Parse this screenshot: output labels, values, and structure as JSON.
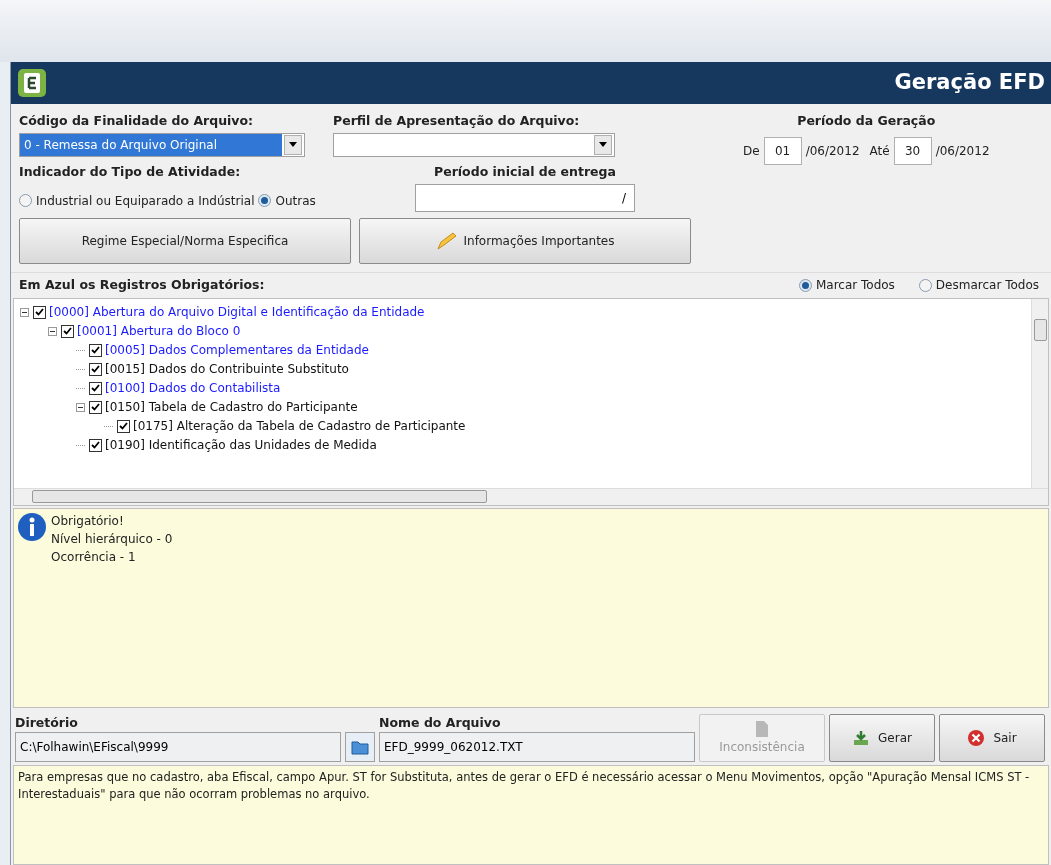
{
  "window": {
    "title": "Geração EFD"
  },
  "finalidade": {
    "label": "Código da Finalidade do Arquivo:",
    "value": "0 - Remessa do Arquivo Original"
  },
  "perfil": {
    "label": "Perfil de Apresentação do Arquivo:"
  },
  "periodo_geracao": {
    "label": "Período da Geração",
    "from_label": "De",
    "from_day": "01",
    "from_rest": "/06/2012",
    "to_label": "Até",
    "to_day": "30",
    "to_rest": "/06/2012"
  },
  "tipo_atividade": {
    "label": "Indicador do Tipo de Atividade:",
    "options": [
      {
        "label": "Industrial ou Equiparado a Indústrial",
        "selected": false
      },
      {
        "label": "Outras",
        "selected": true
      }
    ]
  },
  "periodo_inicial": {
    "label": "Período inicial de entrega",
    "value": "/"
  },
  "buttons": [
    {
      "label": "Regime Especial/Norma Especifica",
      "kind": "plain"
    },
    {
      "label": "Informações Importantes",
      "kind": "pencil"
    }
  ],
  "tree_section": {
    "label": "Em Azul os Registros Obrigatórios:",
    "options": [
      {
        "label": "Marcar Todos",
        "selected": true
      },
      {
        "label": "Desmarcar Todos",
        "selected": false
      }
    ]
  },
  "tree": [
    {
      "label": "[0000] Abertura do Arquivo Digital e Identificação da Entidade",
      "mandatory": true,
      "checked": true,
      "expanded": true,
      "children": [
        {
          "label": "[0001] Abertura do Bloco 0",
          "mandatory": true,
          "checked": true,
          "expanded": true,
          "children": [
            {
              "label": "[0005] Dados Complementares da Entidade",
              "mandatory": true,
              "checked": true
            },
            {
              "label": "[0015] Dados do Contribuinte Substituto",
              "mandatory": false,
              "checked": true
            },
            {
              "label": "[0100] Dados do Contabilista",
              "mandatory": true,
              "checked": true
            },
            {
              "label": "[0150] Tabela de Cadastro do Participante",
              "mandatory": false,
              "checked": true,
              "expanded": true,
              "children": [
                {
                  "label": "[0175] Alteração da Tabela de Cadastro de Participante",
                  "mandatory": false,
                  "checked": true
                }
              ]
            },
            {
              "label": "[0190] Identificação das Unidades de Medida",
              "mandatory": false,
              "checked": true
            }
          ]
        }
      ]
    }
  ],
  "info": {
    "lines": [
      "Obrigatório!",
      "Nível hierárquico - 0",
      "Ocorrência - 1"
    ]
  },
  "diretorio": {
    "label": "Diretório",
    "value": "C:\\Folhawin\\EFiscal\\9999"
  },
  "nome_arquivo": {
    "label": "Nome do Arquivo",
    "value": "EFD_9999_062012.TXT"
  },
  "actions": [
    {
      "label": "Inconsistência",
      "kind": "inconsistencia",
      "disabled": true
    },
    {
      "label": "Gerar",
      "kind": "gerar",
      "disabled": false
    },
    {
      "label": "Sair",
      "kind": "sair",
      "disabled": false
    }
  ],
  "notice": "Para empresas que no cadastro, aba Efiscal, campo Apur. ST for Substituta, antes de gerar o EFD é necessário acessar o Menu Movimentos, opção \"Apuração Mensal ICMS ST - Interestaduais\" para que não ocorram problemas no arquivo."
}
